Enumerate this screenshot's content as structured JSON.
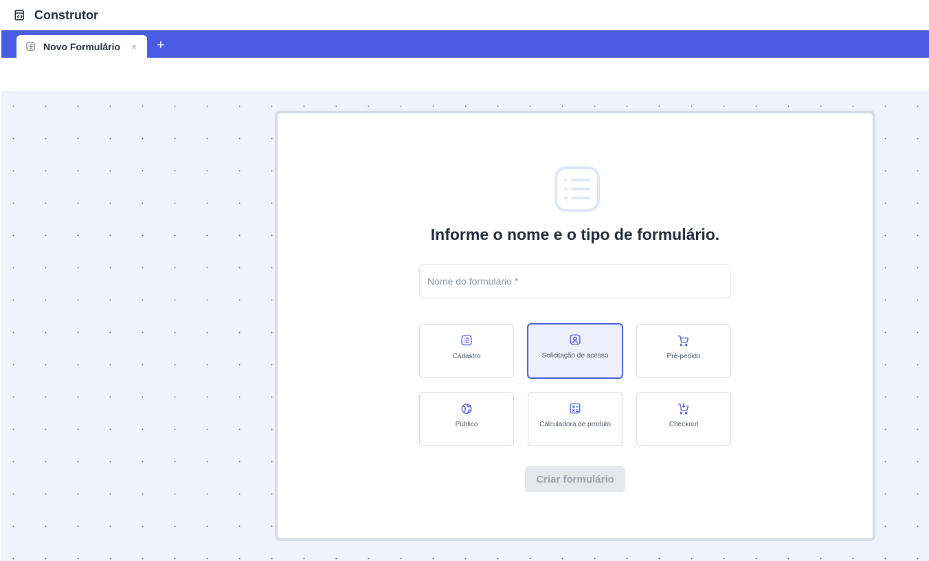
{
  "app": {
    "title": "Construtor",
    "logo_icon": "form-builder-icon"
  },
  "tabs": [
    {
      "label": "Novo Formulário",
      "close": "×",
      "icon": "list-icon"
    }
  ],
  "tab_add": "+",
  "form": {
    "title": "Informe o nome e o tipo de formulário.",
    "name_placeholder": "Nome do formulário *",
    "name_value": "",
    "types": [
      {
        "label": "Cadastro",
        "icon": "list-icon",
        "selected": false
      },
      {
        "label": "Solicitação de acesso",
        "icon": "user-badge-icon",
        "selected": true
      },
      {
        "label": "Pré-pedido",
        "icon": "cart-icon",
        "selected": false
      },
      {
        "label": "Público",
        "icon": "globe-icon",
        "selected": false
      },
      {
        "label": "Calculadora de produto",
        "icon": "calculator-icon",
        "selected": false
      },
      {
        "label": "Checkout",
        "icon": "cart-download-icon",
        "selected": false
      }
    ],
    "create_label": "Criar formulário"
  },
  "colors": {
    "accent": "#4a5be6",
    "canvas": "#f1f2fb",
    "selected_bg": "#eef0fc",
    "disabled_bg": "#e5e7eb"
  }
}
